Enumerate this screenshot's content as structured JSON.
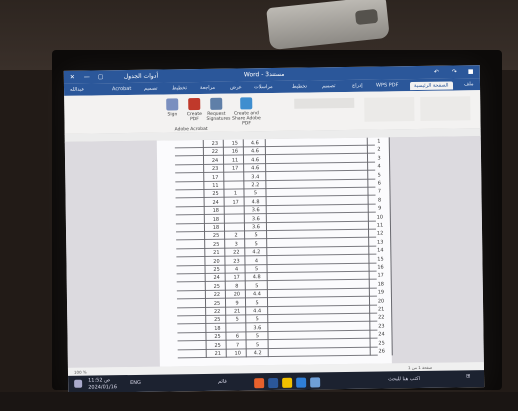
{
  "window": {
    "app_title": "Word - مستند3",
    "account": "عبدالله",
    "left_labels": [
      "أدوات الجدول"
    ],
    "wps_pdf": "WPS PDF"
  },
  "ribbon_tabs": [
    "Acrobat",
    "تصميم",
    "تخطيط",
    "مراجعة",
    "عرض",
    "مراسلات",
    "تخطيط",
    "تصميم",
    "إدراج",
    "الصفحة الرئيسية",
    "ملف"
  ],
  "ribbon": {
    "buttons": [
      "Sign",
      "Create PDF",
      "Request Signatures",
      "Create and Share Adobe PDF"
    ],
    "group_label": "Adobe Acrobat"
  },
  "table": {
    "rows": [
      {
        "idx": "1",
        "a": "23",
        "b": "15",
        "c": "4.6"
      },
      {
        "idx": "2",
        "a": "22",
        "b": "16",
        "c": "4.6"
      },
      {
        "idx": "3",
        "a": "24",
        "b": "11",
        "c": "4.6"
      },
      {
        "idx": "4",
        "a": "23",
        "b": "17",
        "c": "4.6"
      },
      {
        "idx": "5",
        "a": "17",
        "b": "",
        "c": "3.4"
      },
      {
        "idx": "6",
        "a": "11",
        "b": "",
        "c": "2.2"
      },
      {
        "idx": "7",
        "a": "25",
        "b": "1",
        "c": "5"
      },
      {
        "idx": "8",
        "a": "24",
        "b": "17",
        "c": "4.8"
      },
      {
        "idx": "9",
        "a": "18",
        "b": "",
        "c": "3.6"
      },
      {
        "idx": "10",
        "a": "18",
        "b": "",
        "c": "3.6"
      },
      {
        "idx": "11",
        "a": "18",
        "b": "",
        "c": "3.6"
      },
      {
        "idx": "12",
        "a": "25",
        "b": "2",
        "c": "5"
      },
      {
        "idx": "13",
        "a": "25",
        "b": "3",
        "c": "5"
      },
      {
        "idx": "14",
        "a": "21",
        "b": "22",
        "c": "4.2"
      },
      {
        "idx": "15",
        "a": "20",
        "b": "23",
        "c": "4"
      },
      {
        "idx": "16",
        "a": "25",
        "b": "4",
        "c": "5"
      },
      {
        "idx": "17",
        "a": "24",
        "b": "17",
        "c": "4.8"
      },
      {
        "idx": "18",
        "a": "25",
        "b": "8",
        "c": "5"
      },
      {
        "idx": "19",
        "a": "22",
        "b": "20",
        "c": "4.4"
      },
      {
        "idx": "20",
        "a": "25",
        "b": "9",
        "c": "5"
      },
      {
        "idx": "21",
        "a": "22",
        "b": "21",
        "c": "4.4"
      },
      {
        "idx": "22",
        "a": "25",
        "b": "5",
        "c": "5"
      },
      {
        "idx": "23",
        "a": "18",
        "b": "",
        "c": "3.6"
      },
      {
        "idx": "24",
        "a": "25",
        "b": "6",
        "c": "5"
      },
      {
        "idx": "25",
        "a": "25",
        "b": "7",
        "c": "5"
      },
      {
        "idx": "26",
        "a": "21",
        "b": "10",
        "c": "4.2"
      }
    ]
  },
  "status": {
    "zoom": "100 %",
    "page_info": "صفحة 1 من 1"
  },
  "taskbar": {
    "time": "11:52 ص",
    "date": "2024/01/16",
    "lang": "ENG",
    "search": "اكتب هنا للبحث",
    "weather": "غائم"
  }
}
